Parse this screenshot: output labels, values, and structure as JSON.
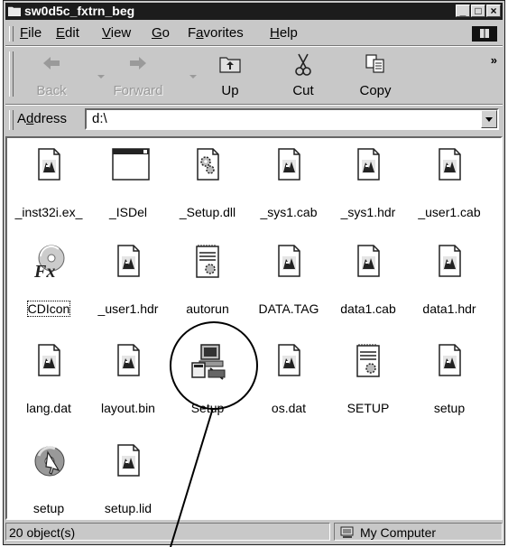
{
  "window": {
    "title": "sw0d5c_fxtrn_beg"
  },
  "title_buttons": [
    "_",
    "□",
    "×"
  ],
  "menu": [
    {
      "label": "File",
      "access": "F",
      "rest": "ile"
    },
    {
      "label": "Edit",
      "access": "E",
      "rest": "dit"
    },
    {
      "label": "View",
      "access": "V",
      "rest": "iew"
    },
    {
      "label": "Go",
      "access": "G",
      "rest": "o"
    },
    {
      "label": "Favorites",
      "pre": "F",
      "access": "a",
      "rest": "vorites"
    },
    {
      "label": "Help",
      "access": "H",
      "rest": "elp"
    }
  ],
  "toolbar": {
    "back": {
      "label": "Back",
      "icon": "back-arrow-icon",
      "enabled": false
    },
    "forward": {
      "label": "Forward",
      "icon": "forward-arrow-icon",
      "enabled": false
    },
    "up": {
      "label": "Up",
      "icon": "up-folder-icon",
      "enabled": true
    },
    "cut": {
      "label": "Cut",
      "icon": "scissors-icon",
      "enabled": true
    },
    "copy": {
      "label": "Copy",
      "icon": "copy-icon",
      "enabled": true
    },
    "more": "»"
  },
  "address": {
    "label": "Address",
    "value": "d:\\"
  },
  "files": [
    {
      "name": "_inst32i.ex_",
      "icon": "generic-file-icon"
    },
    {
      "name": "_ISDel",
      "icon": "application-window-icon"
    },
    {
      "name": "_Setup.dll",
      "icon": "dll-gear-icon"
    },
    {
      "name": "_sys1.cab",
      "icon": "generic-file-icon"
    },
    {
      "name": "_sys1.hdr",
      "icon": "generic-file-icon"
    },
    {
      "name": "_user1.cab",
      "icon": "generic-file-icon"
    },
    {
      "name": "CDIcon",
      "icon": "fx-cd-icon",
      "focused": true
    },
    {
      "name": "_user1.hdr",
      "icon": "generic-file-icon"
    },
    {
      "name": "autorun",
      "icon": "setup-info-icon"
    },
    {
      "name": "DATA.TAG",
      "icon": "generic-file-icon"
    },
    {
      "name": "data1.cab",
      "icon": "generic-file-icon"
    },
    {
      "name": "data1.hdr",
      "icon": "generic-file-icon"
    },
    {
      "name": "lang.dat",
      "icon": "generic-file-icon"
    },
    {
      "name": "layout.bin",
      "icon": "generic-file-icon"
    },
    {
      "name": "Setup",
      "icon": "setup-computer-icon",
      "circled": true
    },
    {
      "name": "os.dat",
      "icon": "generic-file-icon"
    },
    {
      "name": "SETUP",
      "icon": "setup-info-icon"
    },
    {
      "name": "setup",
      "icon": "generic-file-icon"
    },
    {
      "name": "setup",
      "icon": "setup-cd-arrow-icon"
    },
    {
      "name": "setup.lid",
      "icon": "generic-file-icon"
    }
  ],
  "status": {
    "count": "20 object(s)",
    "zone": "My Computer"
  }
}
